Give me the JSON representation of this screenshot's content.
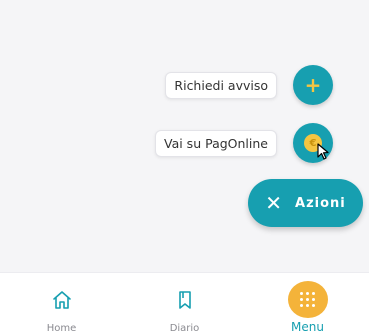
{
  "fab_menu": {
    "items": [
      {
        "label": "Richiedi avviso",
        "icon": "plus-icon"
      },
      {
        "label": "Vai su PagOnline",
        "icon": "coin-icon"
      }
    ],
    "plus_glyph": "+",
    "coin_glyph": "€",
    "main_button": {
      "label": "Azioni",
      "icon": "close-icon",
      "icon_glyph": "✕"
    }
  },
  "bottom_nav": {
    "items": [
      {
        "label": "Home",
        "icon": "home-icon",
        "active": false
      },
      {
        "label": "Diario",
        "icon": "bookmark-icon",
        "active": false
      },
      {
        "label": "Menu",
        "icon": "grid-icon",
        "active": true
      }
    ]
  },
  "colors": {
    "primary": "#179fb0",
    "accent": "#f4c542",
    "menu_accent": "#f4b33a",
    "background": "#f5f5f7"
  }
}
